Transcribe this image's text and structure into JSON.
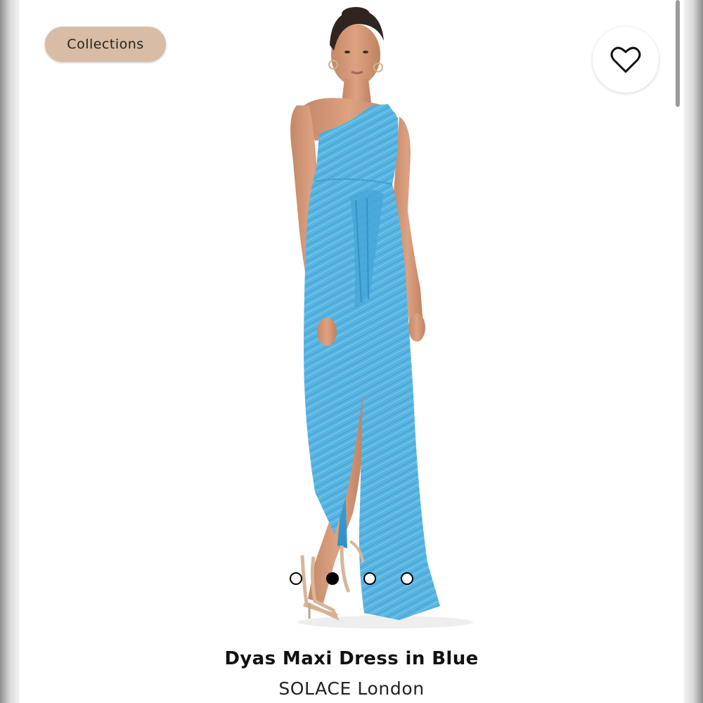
{
  "header": {
    "collections_label": "Collections",
    "favorite_icon": "heart-outline-icon"
  },
  "gallery": {
    "image_alt": "Model wearing a light blue one-shoulder pleated maxi dress with thigh slit and nude strappy heels",
    "dress_color": "#55b3e0",
    "total_images": 4,
    "active_index": 1
  },
  "product": {
    "name": "Dyas Maxi Dress in Blue",
    "brand": "SOLACE London"
  },
  "colors": {
    "pill_background": "#d8bca5",
    "dot_active": "#000000",
    "dot_inactive": "#ffffff"
  }
}
